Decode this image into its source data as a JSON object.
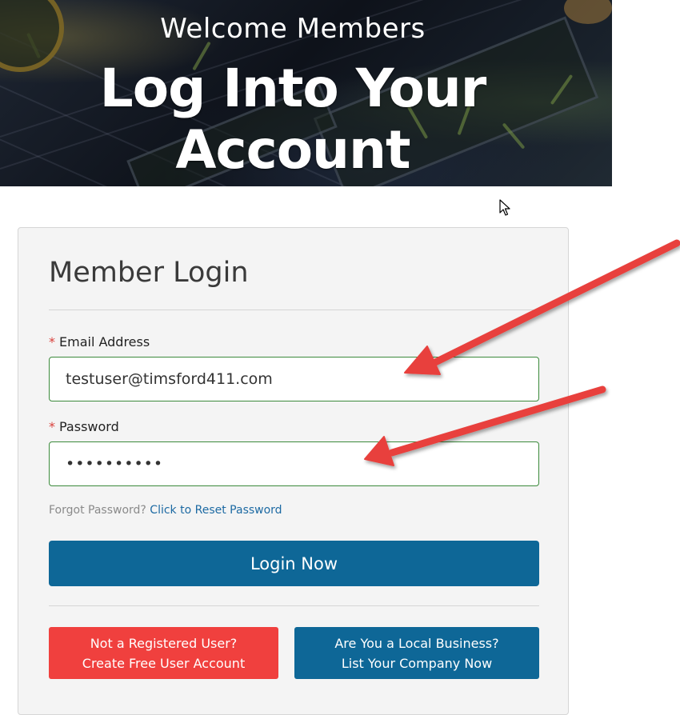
{
  "hero": {
    "subtitle": "Welcome Members",
    "title": "Log Into Your Account"
  },
  "login": {
    "heading": "Member Login",
    "email": {
      "required_mark": "*",
      "label": "Email Address",
      "value": "testuser@timsford411.com"
    },
    "password": {
      "required_mark": "*",
      "label": "Password",
      "value": "••••••••••"
    },
    "forgot": {
      "text": "Forgot Password?",
      "link": "Click to Reset Password"
    },
    "login_button": "Login Now",
    "register_button": {
      "line1": "Not a Registered User?",
      "line2": "Create Free User Account"
    },
    "business_button": {
      "line1": "Are You a Local Business?",
      "line2": "List Your Company Now"
    }
  },
  "colors": {
    "primary": "#0e6797",
    "danger": "#f0403e",
    "input_border": "#3c8a3c",
    "required": "#d9413c",
    "link": "#1d6aa3",
    "annotation_arrow": "#e8413c"
  }
}
